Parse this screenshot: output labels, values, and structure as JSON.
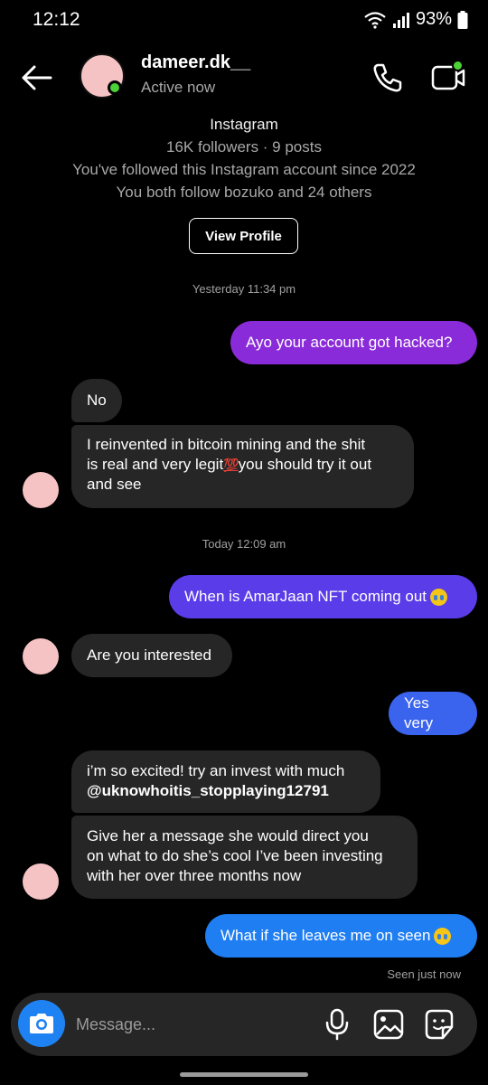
{
  "status_bar": {
    "time": "12:12",
    "battery": "93%"
  },
  "header": {
    "username": "dameer.dk__",
    "status": "Active now"
  },
  "profile": {
    "platform": "Instagram",
    "stats": "16K followers · 9 posts",
    "followed_since": "You've followed this Instagram account since 2022",
    "mutual": "You both follow bozuko and 24 others",
    "view_profile_label": "View Profile"
  },
  "timestamps": {
    "first": "Yesterday 11:34 pm",
    "second": "Today 12:09 am"
  },
  "messages": {
    "m1": "Ayo your account got hacked?",
    "m2": "No",
    "m3_line1": "I reinvented in bitcoin mining and the shit",
    "m3_line2": "is real and very legit",
    "m3_line2_emoji": "💯",
    "m3_line2_tail": "you should try it out",
    "m3_line3": "and see",
    "m4": "When is AmarJaan NFT coming out",
    "m5": "Are you interested",
    "m6": "Yes very",
    "m7_line1": "i’m so excited! try an invest with much",
    "m7_line2": "@uknowhoitis_stopplaying12791",
    "m8_line1": "Give her a message she would direct you",
    "m8_line2": "on what to do she’s cool I’ve been investing",
    "m8_line3": "with her over three months now",
    "m9": "What if she leaves me on seen"
  },
  "seen_label": "Seen just now",
  "composer": {
    "placeholder": "Message..."
  },
  "icons": {
    "back": "arrow-left-icon",
    "call": "phone-icon",
    "video": "video-camera-icon",
    "camera": "camera-icon",
    "mic": "microphone-icon",
    "gallery": "image-icon",
    "sticker": "sticker-icon"
  },
  "colors": {
    "online": "#4cd137",
    "accent_blue": "#1f82f2",
    "bubble_purple": "#8a2bd9",
    "bubble_violet": "#5a3ce8",
    "bubble_blue": "#1f7ef2",
    "incoming": "#262626",
    "avatar": "#f6c3c4"
  }
}
